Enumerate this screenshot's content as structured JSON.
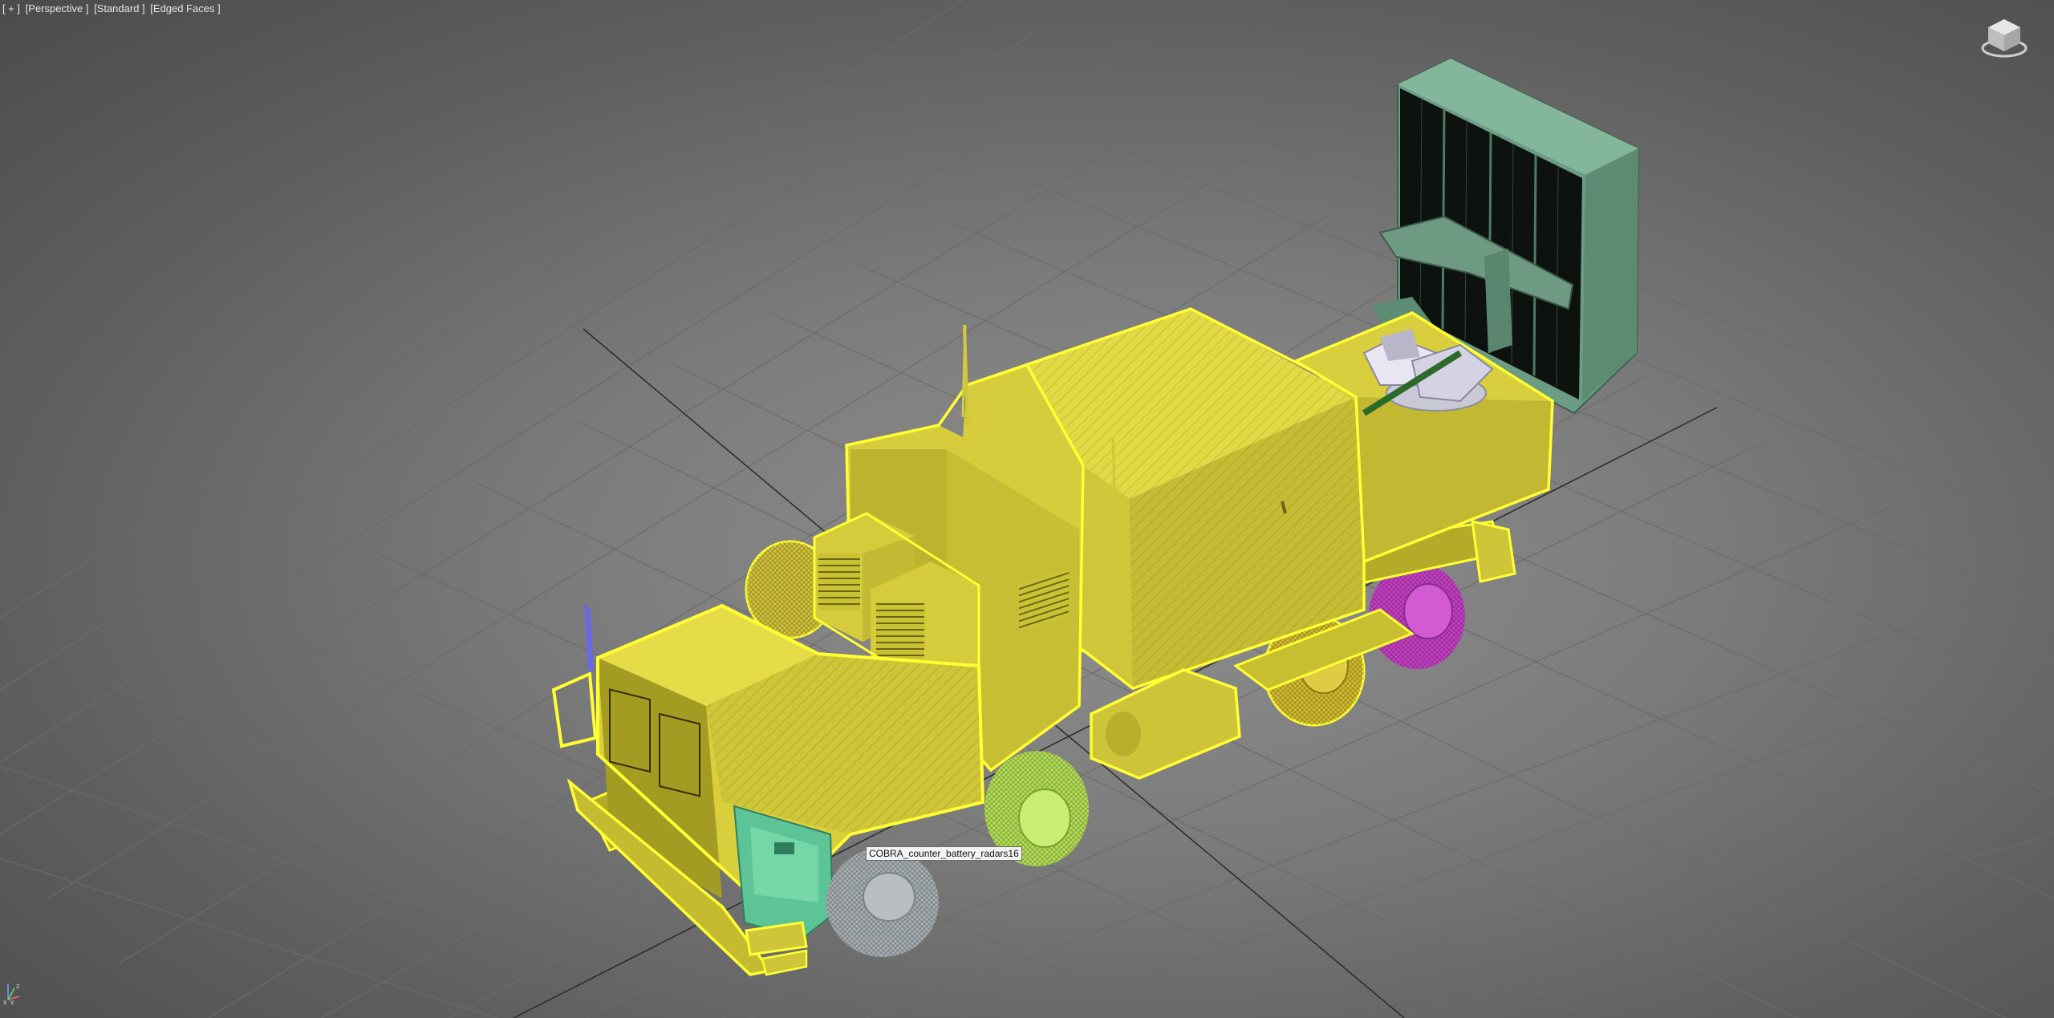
{
  "viewport": {
    "labels": [
      "[ + ]",
      "[Perspective ]",
      "[Standard ]",
      "[Edged Faces ]"
    ]
  },
  "scene": {
    "tooltip": "COBRA_counter_battery_radars16",
    "selection_color": "#ffff33",
    "body_color": "#d9d13a",
    "radar_color": "#6f9e86",
    "wheel_colors": {
      "front_left": "#a9b0b3",
      "middle": "#b9e35a",
      "rear_right": "#cc3fcc",
      "rear_left": "#d9c23a"
    },
    "door_color": "#5fc79a",
    "grid_color": "#6a6a6a"
  },
  "axis": {
    "x": "x",
    "y": "y",
    "z": "z"
  }
}
